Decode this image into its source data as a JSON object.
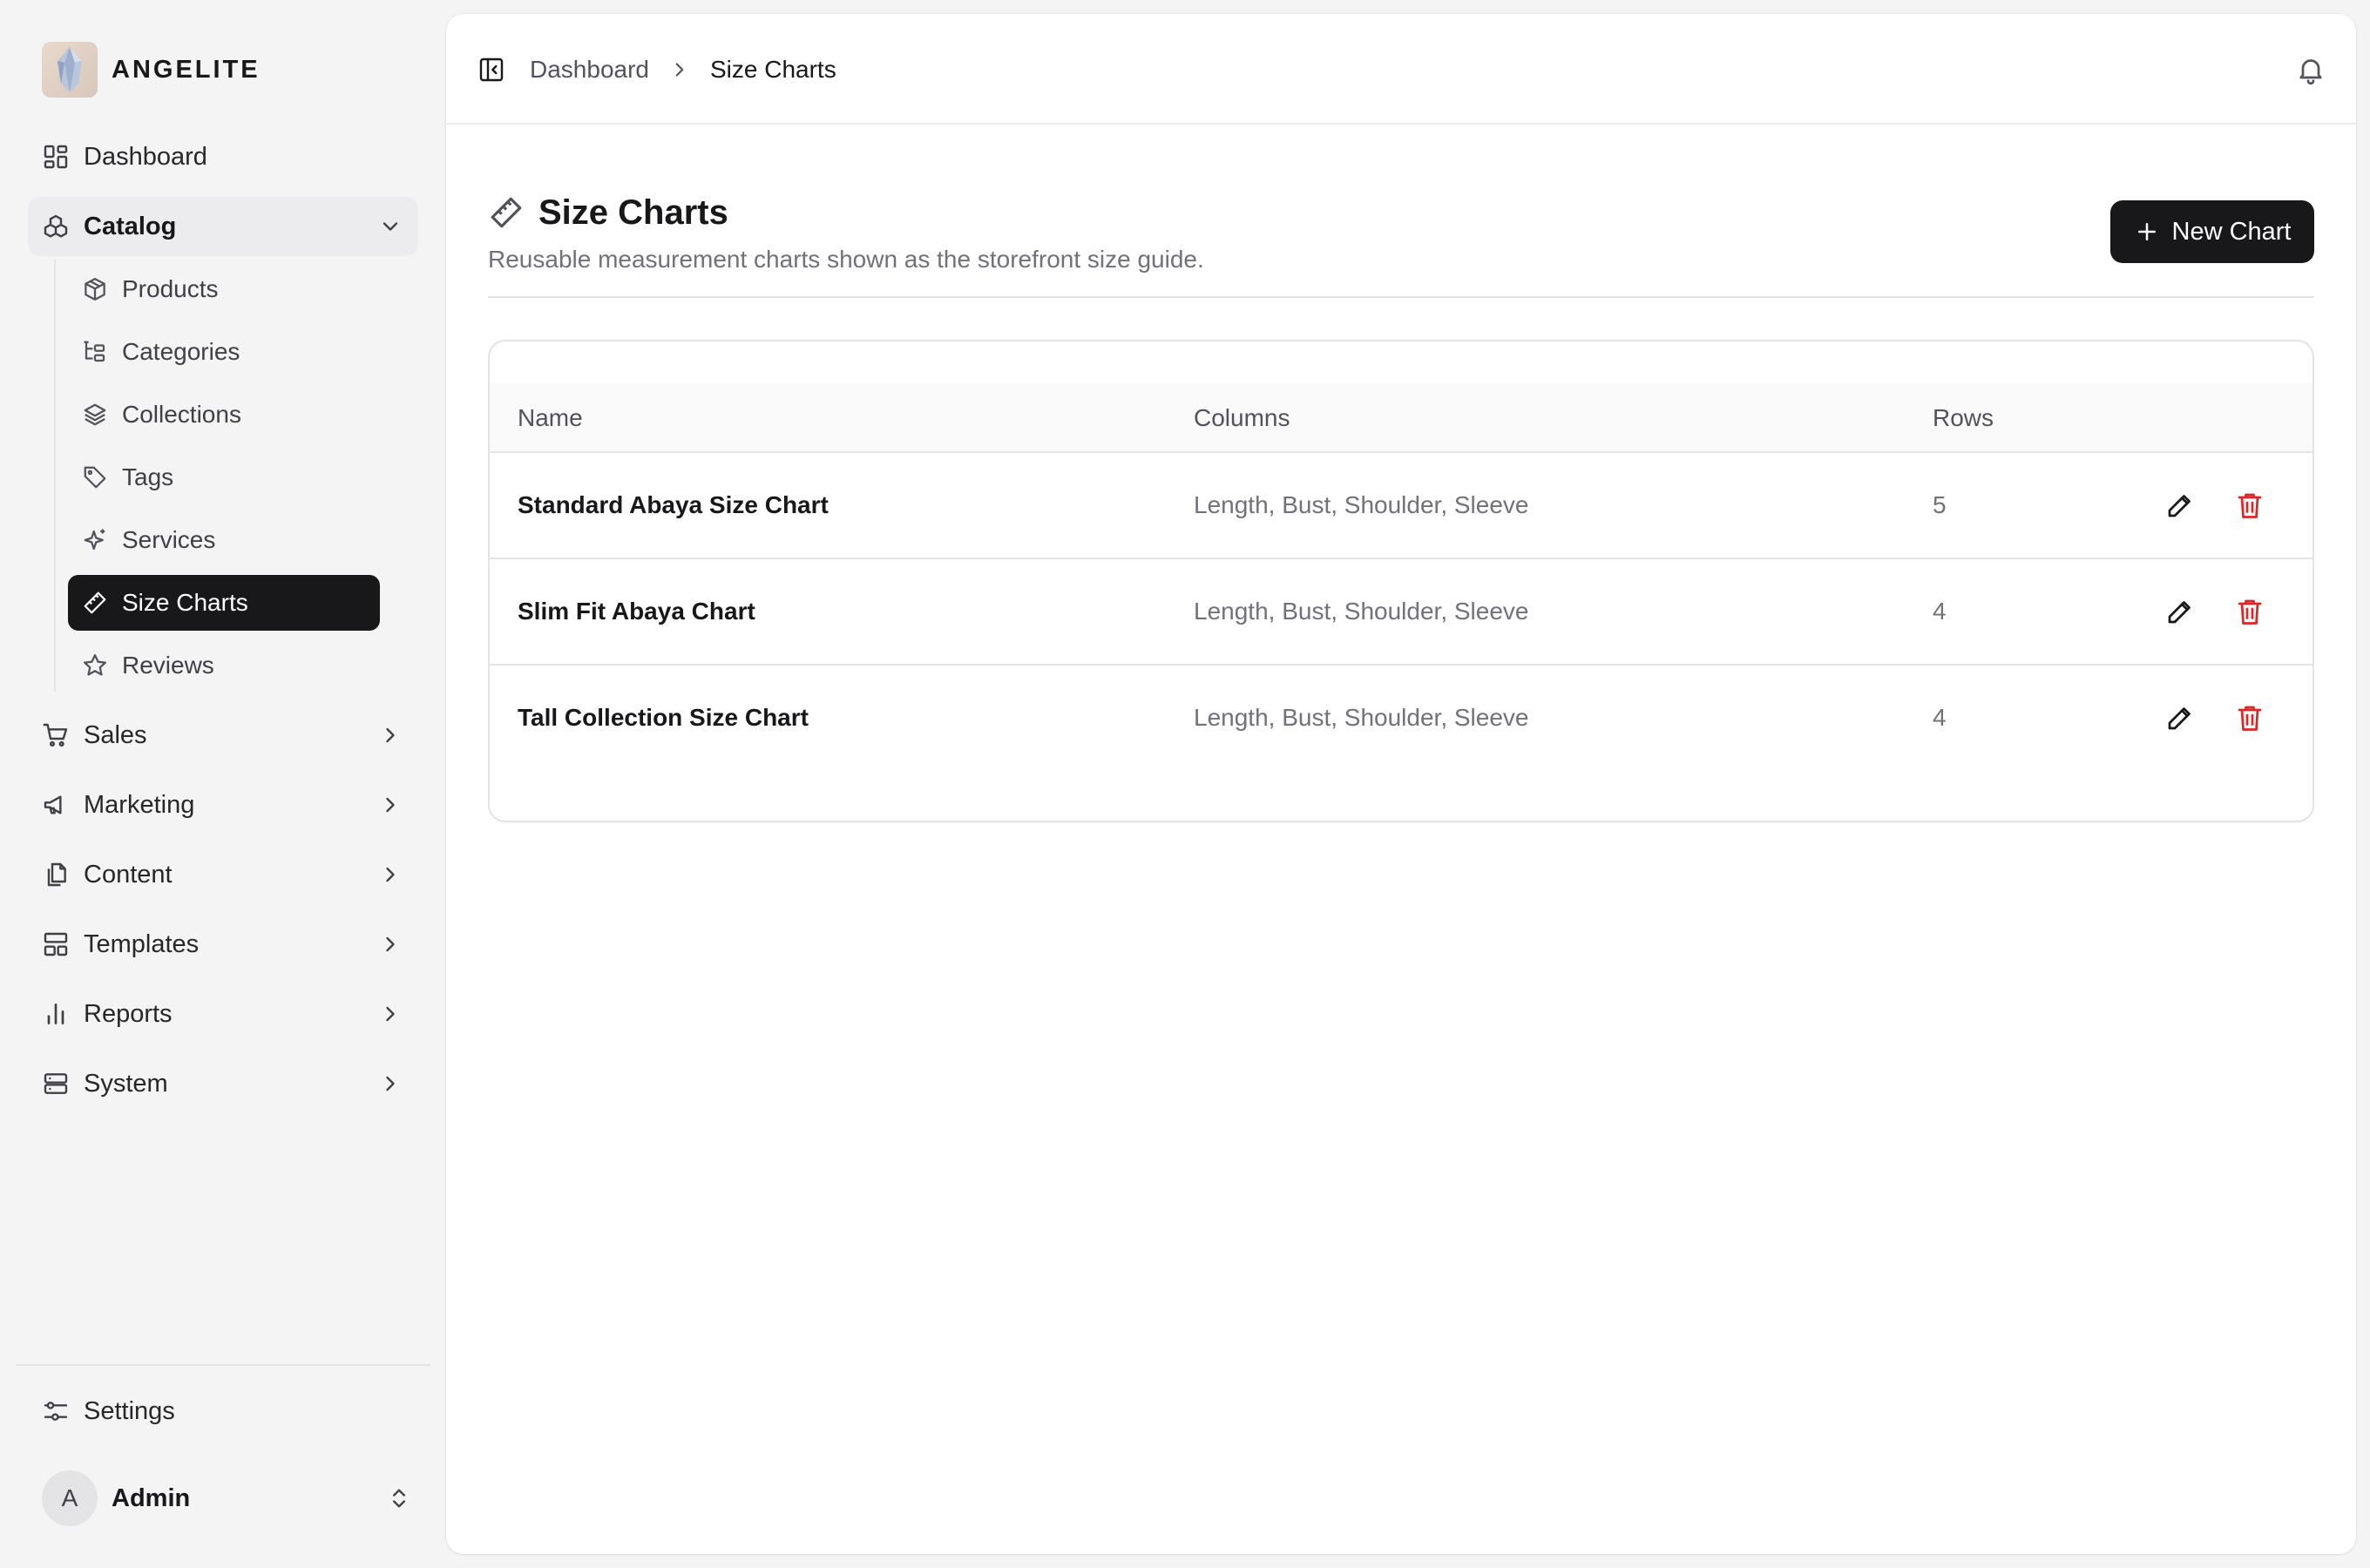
{
  "brand": {
    "name": "ANGELITE"
  },
  "sidebar": {
    "top_items": [
      {
        "label": "Dashboard",
        "icon": "dashboard-icon"
      }
    ],
    "catalog": {
      "label": "Catalog",
      "icon": "catalog-icon",
      "expanded": true,
      "items": [
        {
          "label": "Products",
          "icon": "box-icon"
        },
        {
          "label": "Categories",
          "icon": "tree-icon"
        },
        {
          "label": "Collections",
          "icon": "layers-icon"
        },
        {
          "label": "Tags",
          "icon": "tag-icon"
        },
        {
          "label": "Services",
          "icon": "sparkles-icon"
        },
        {
          "label": "Size Charts",
          "icon": "ruler-icon",
          "active": true
        },
        {
          "label": "Reviews",
          "icon": "star-icon"
        }
      ]
    },
    "groups": [
      {
        "label": "Sales",
        "icon": "cart-icon"
      },
      {
        "label": "Marketing",
        "icon": "megaphone-icon"
      },
      {
        "label": "Content",
        "icon": "files-icon"
      },
      {
        "label": "Templates",
        "icon": "layout-icon"
      },
      {
        "label": "Reports",
        "icon": "bar-chart-icon"
      },
      {
        "label": "System",
        "icon": "server-icon"
      }
    ],
    "settings": {
      "label": "Settings",
      "icon": "sliders-icon"
    },
    "user": {
      "initial": "A",
      "name": "Admin"
    }
  },
  "header": {
    "breadcrumb": [
      {
        "label": "Dashboard"
      },
      {
        "label": "Size Charts"
      }
    ]
  },
  "page": {
    "title": "Size Charts",
    "subtitle": "Reusable measurement charts shown as the storefront size guide.",
    "new_button": "New Chart"
  },
  "table": {
    "headers": {
      "name": "Name",
      "columns": "Columns",
      "rows": "Rows"
    },
    "rows": [
      {
        "name": "Standard Abaya Size Chart",
        "columns": "Length, Bust, Shoulder, Sleeve",
        "rows": "5"
      },
      {
        "name": "Slim Fit Abaya Chart",
        "columns": "Length, Bust, Shoulder, Sleeve",
        "rows": "4"
      },
      {
        "name": "Tall Collection Size Chart",
        "columns": "Length, Bust, Shoulder, Sleeve",
        "rows": "4"
      }
    ]
  },
  "colors": {
    "accent": "#18181b",
    "danger": "#dc2626",
    "sidebar_bg": "#f4f4f5",
    "muted_text": "#71717a"
  }
}
